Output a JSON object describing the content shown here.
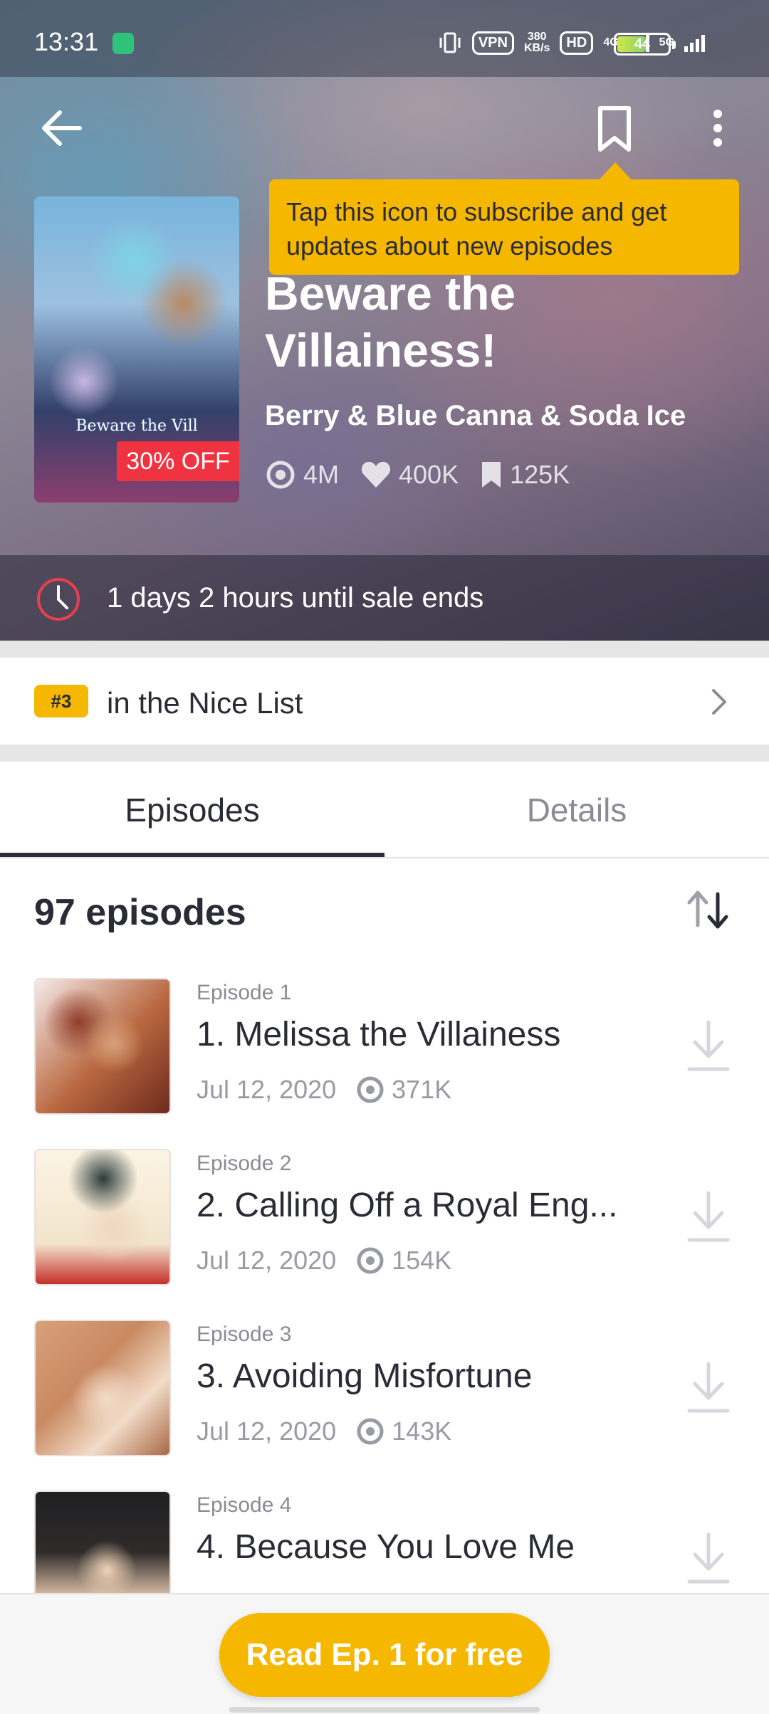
{
  "status_bar": {
    "time": "13:31",
    "vpn": "VPN",
    "speed_top": "380",
    "speed_bottom": "KB/s",
    "hd": "HD",
    "net_4g": "4G",
    "net_5g": "5G",
    "battery": "44"
  },
  "header": {
    "back_icon": "arrow-left-icon",
    "bookmark_icon": "bookmark-icon",
    "more_icon": "more-vertical-icon"
  },
  "tooltip": {
    "text": "Tap this icon to subscribe and get updates about new episodes"
  },
  "series": {
    "cover_title": "Beware the Vill",
    "sale_badge": "30% OFF",
    "title": "Beware the Villainess!",
    "author": "Berry & Blue Canna & Soda Ice",
    "views": "4M",
    "likes": "400K",
    "subscribers": "125K"
  },
  "sale": {
    "countdown": "1 days 2 hours until sale ends"
  },
  "ranking": {
    "badge": "#3",
    "label": "in the Nice List"
  },
  "tabs": {
    "episodes": "Episodes",
    "details": "Details"
  },
  "episode_list": {
    "count_label": "97 episodes",
    "items": [
      {
        "number": "Episode 1",
        "title": "1. Melissa the Villainess",
        "date": "Jul 12, 2020",
        "views": "371K"
      },
      {
        "number": "Episode 2",
        "title": "2. Calling Off a Royal Eng...",
        "date": "Jul 12, 2020",
        "views": "154K"
      },
      {
        "number": "Episode 3",
        "title": "3. Avoiding Misfortune",
        "date": "Jul 12, 2020",
        "views": "143K"
      },
      {
        "number": "Episode 4",
        "title": "4. Because You Love Me",
        "date": "",
        "views": ""
      }
    ]
  },
  "cta": {
    "read_label": "Read Ep. 1 for free"
  },
  "colors": {
    "accent": "#f5b700",
    "sale_red": "#ef3340",
    "text_dark": "#2b2b36"
  }
}
